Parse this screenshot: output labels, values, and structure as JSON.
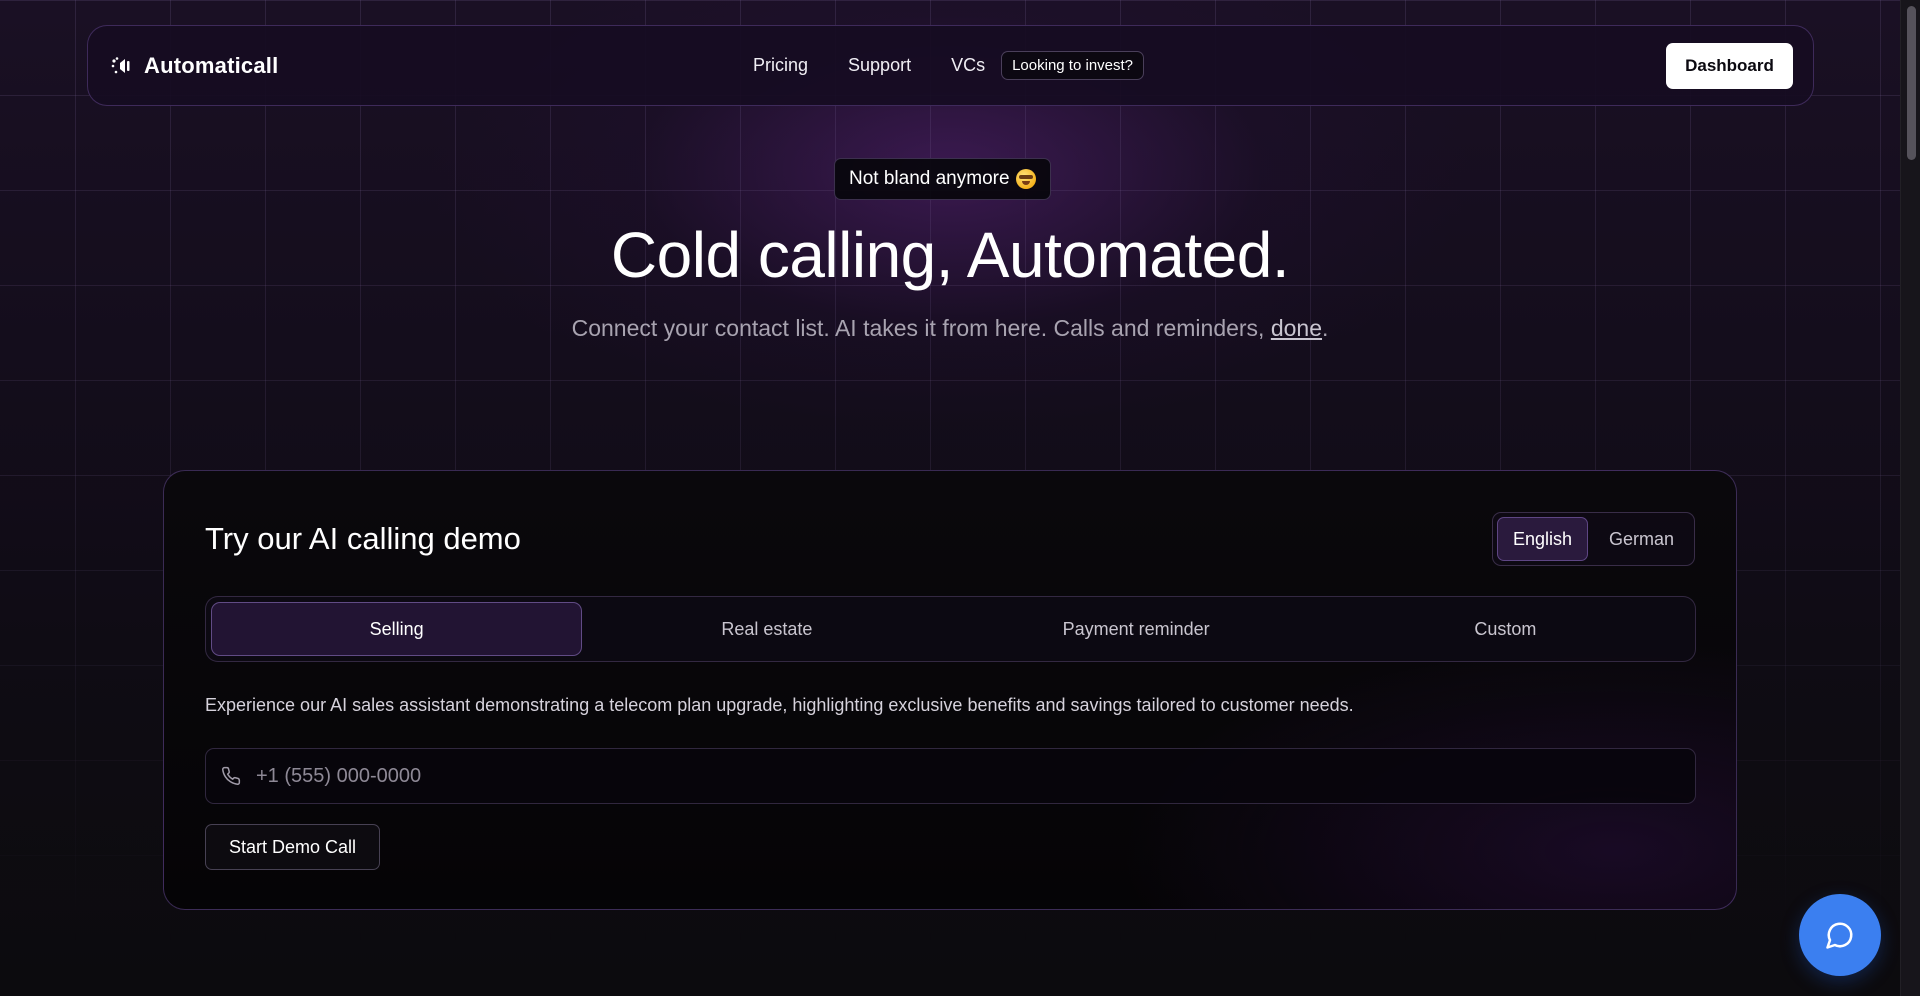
{
  "nav": {
    "brand": "Automaticall",
    "links": [
      "Pricing",
      "Support",
      "VCs"
    ],
    "invest_label": "Looking to invest?",
    "dashboard_label": "Dashboard"
  },
  "hero": {
    "badge": "Not bland anymore",
    "badge_emoji_icon": "star-struck-emoji-icon",
    "title": "Cold calling, Automated.",
    "subtitle_prefix": "Connect your contact list. AI takes it from here. Calls and reminders, ",
    "subtitle_link": "done",
    "subtitle_suffix": "."
  },
  "demo": {
    "title": "Try our AI calling demo",
    "languages": [
      "English",
      "German"
    ],
    "selected_language": "English",
    "tabs": [
      "Selling",
      "Real estate",
      "Payment reminder",
      "Custom"
    ],
    "selected_tab": "Selling",
    "description": "Experience our AI sales assistant demonstrating a telecom plan upgrade, highlighting exclusive benefits and savings tailored to customer needs.",
    "phone_placeholder": "+1 (555) 000-0000",
    "phone_value": "",
    "start_label": "Start Demo Call"
  },
  "chat": {
    "icon": "chat-bubble-icon"
  },
  "colors": {
    "accent_blue": "#3b7ff0",
    "active_purple": "#221433",
    "background": "#0c0a10"
  }
}
